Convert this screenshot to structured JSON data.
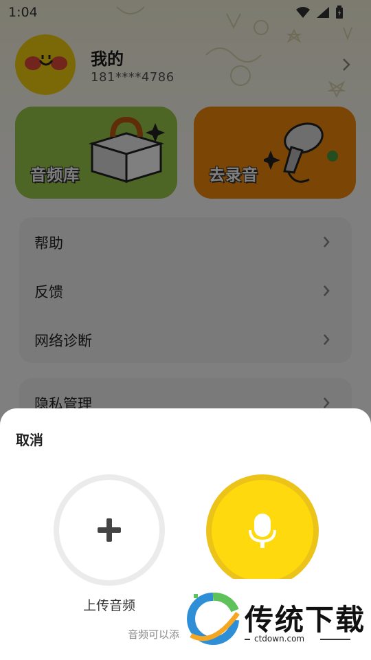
{
  "status_bar": {
    "time": "1:04"
  },
  "profile": {
    "name": "我的",
    "phone": "181****4786"
  },
  "entries": [
    {
      "label": "音频库",
      "color": "#9acb4a"
    },
    {
      "label": "去录音",
      "color": "#f58b0a"
    }
  ],
  "menu_group_1": [
    {
      "label": "帮助"
    },
    {
      "label": "反馈"
    },
    {
      "label": "网络诊断"
    }
  ],
  "menu_group_2": [
    {
      "label": "隐私管理"
    }
  ],
  "sheet": {
    "cancel_label": "取消",
    "upload_label": "上传音频",
    "hint": "音频可以添"
  },
  "watermark": {
    "brand": "传统下载",
    "url": "ctdown.com"
  },
  "colors": {
    "accent_yellow": "#fdd90e",
    "green_card": "#9acb4a",
    "orange_card": "#f58b0a"
  }
}
